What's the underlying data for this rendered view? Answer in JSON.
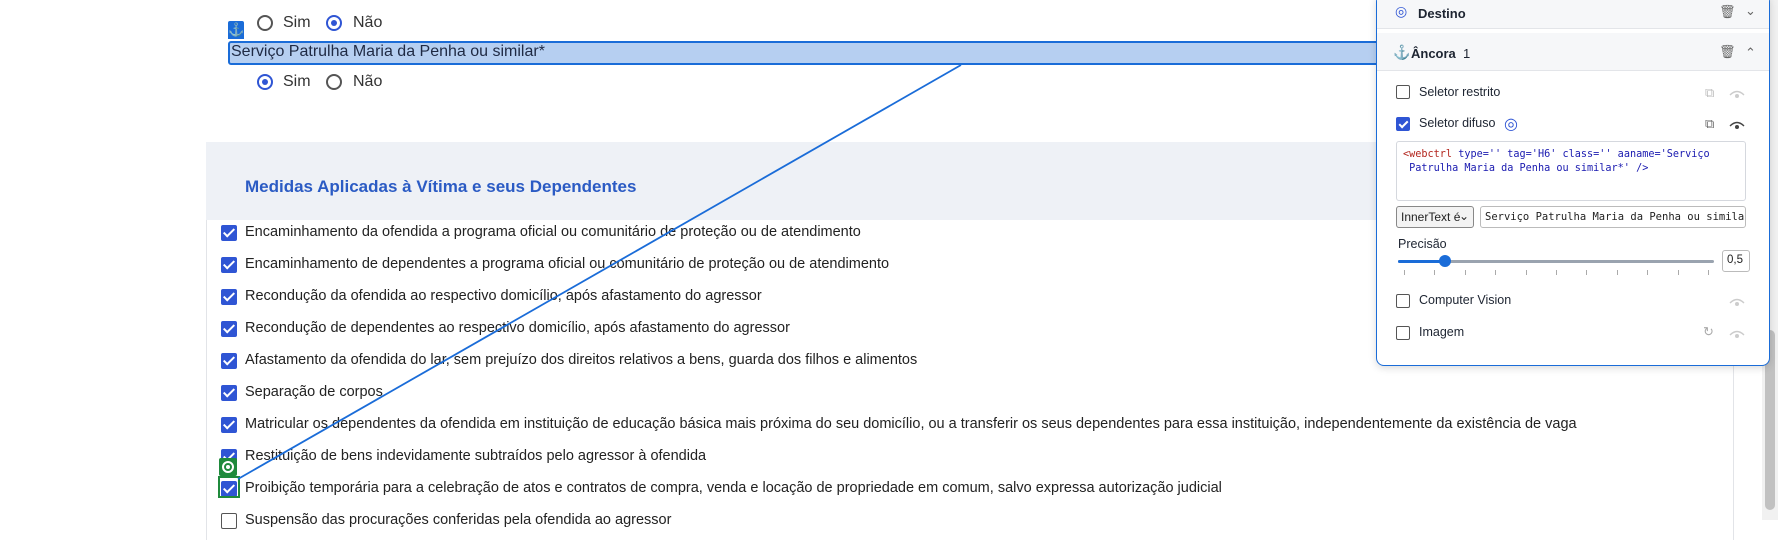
{
  "form": {
    "question1_radio": {
      "sim": "Sim",
      "nao": "Não",
      "selected": "nao"
    },
    "question2": {
      "label": "Serviço Patrulha Maria da Penha ou similar*",
      "sim": "Sim",
      "nao": "Não",
      "selected": "sim"
    },
    "section_title": "Medidas Aplicadas à Vítima e seus Dependentes",
    "items": [
      {
        "label": "Encaminhamento da ofendida a programa oficial ou comunitário de proteção ou de atendimento",
        "checked": true
      },
      {
        "label": "Encaminhamento de dependentes a programa oficial ou comunitário de proteção ou de atendimento",
        "checked": true
      },
      {
        "label": "Recondução da ofendida ao respectivo domicílio, após afastamento do agressor",
        "checked": true
      },
      {
        "label": "Recondução de dependentes ao respectivo domicílio, após afastamento do agressor",
        "checked": true
      },
      {
        "label": "Afastamento da ofendida do lar, sem prejuízo dos direitos relativos a bens, guarda dos filhos e alimentos",
        "checked": true
      },
      {
        "label": "Separação de corpos",
        "checked": true
      },
      {
        "label": "Matricular os dependentes da ofendida em instituição de educação básica mais próxima do seu domicílio, ou a transferir os seus dependentes para essa instituição, independentemente da existência de vaga",
        "checked": true
      },
      {
        "label": "Restituição de bens indevidamente subtraídos pelo agressor à ofendida",
        "checked": true
      },
      {
        "label": "Proibição temporária para a celebração de atos e contratos de compra, venda e locação de propriedade em comum, salvo expressa autorização judicial",
        "checked": true
      },
      {
        "label": "Suspensão das procurações conferidas pela ofendida ao agressor",
        "checked": false
      }
    ]
  },
  "panel": {
    "destino_label": "Destino",
    "ancora_label": "Âncora",
    "ancora_count": "1",
    "strict_selector_label": "Seletor restrito",
    "strict_selector_checked": false,
    "fuzzy_selector_label": "Seletor difuso",
    "fuzzy_selector_checked": true,
    "selector_code_line1_tag": "<webctrl",
    "selector_code_line1_rest": " type='' tag='H6' class='' aaname='Serviço",
    "selector_code_line2": "Patrulha Maria da Penha ou similar*' />",
    "match_mode": "InnerText é",
    "match_value": "Serviço Patrulha Maria da Penha ou similar*",
    "precision_label": "Precisão",
    "precision_value": "0,5",
    "precision_fraction": 0.15,
    "computer_vision_label": "Computer Vision",
    "computer_vision_checked": false,
    "image_label": "Imagem",
    "image_checked": false
  },
  "colors": {
    "accent": "#2f55d4",
    "anchor_blue": "#1a6cd8",
    "target_green": "#1f8a3c",
    "highlight": "#b6cff1"
  }
}
